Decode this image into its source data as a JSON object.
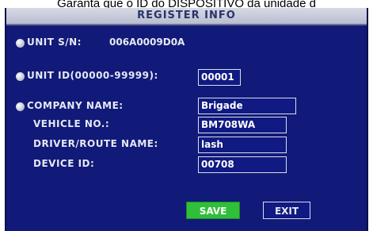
{
  "caption": "Garanta que o ID do DISPOSITIVO da unidade d",
  "window": {
    "title": "REGISTER INFO"
  },
  "unit_sn": {
    "label": "UNIT S/N:",
    "value": "006A0009D0A"
  },
  "unit_id": {
    "label": "UNIT ID(00000-99999):",
    "value": "00001"
  },
  "company_name": {
    "label": "COMPANY NAME:",
    "value": "Brigade"
  },
  "vehicle_no": {
    "label": "VEHICLE NO.:",
    "value": "BM708WA"
  },
  "driver_route": {
    "label": "DRIVER/ROUTE NAME:",
    "value": "lash"
  },
  "device_id": {
    "label": "DEVICE ID:",
    "value": "00708"
  },
  "buttons": {
    "save": "SAVE",
    "exit": "EXIT"
  },
  "colors": {
    "panel_background": "#111a78",
    "save_button": "#2fbf3a",
    "title_bar": "#c8cbdc"
  }
}
